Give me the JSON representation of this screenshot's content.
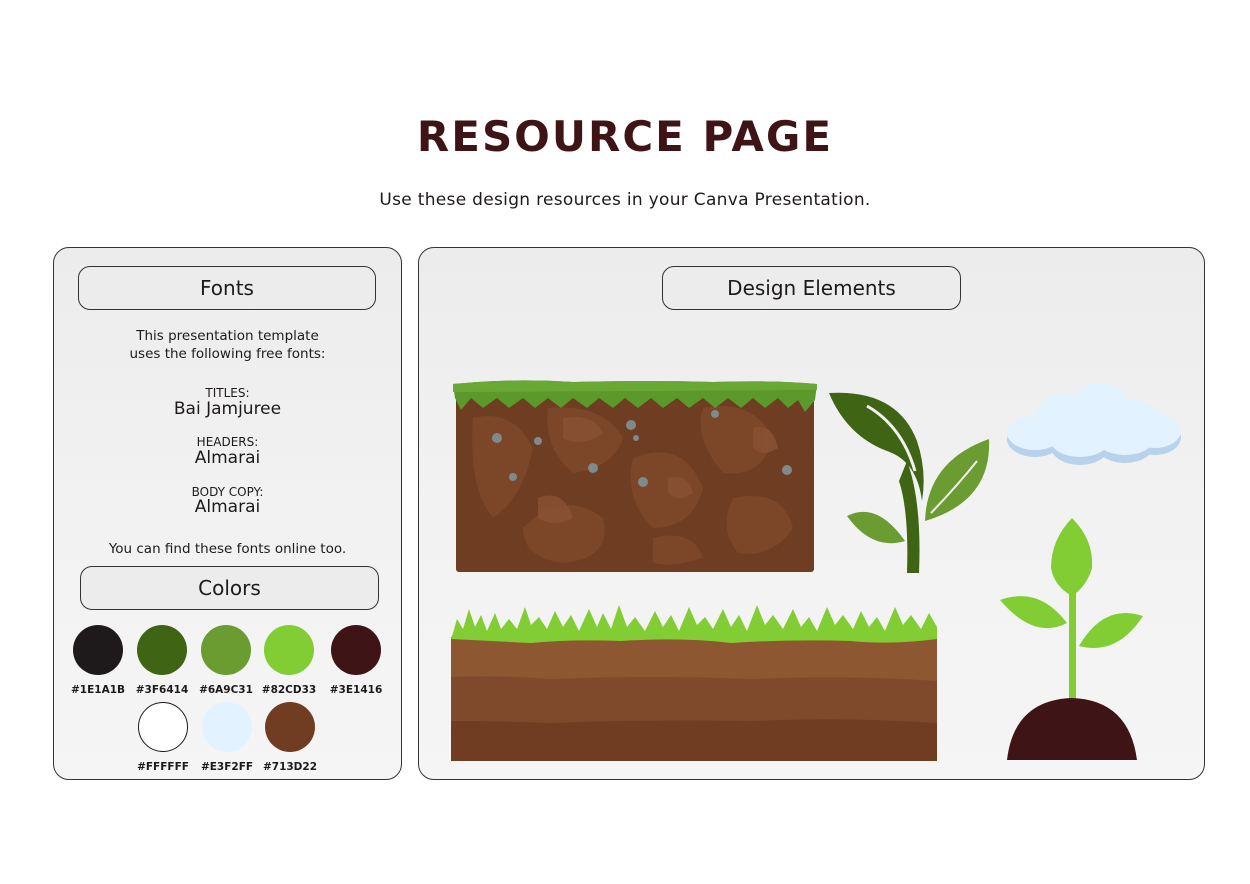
{
  "page": {
    "title": "RESOURCE PAGE",
    "subtitle": "Use these design resources in your Canva Presentation."
  },
  "fonts_panel": {
    "header": "Fonts",
    "intro_line1": "This presentation template",
    "intro_line2": "uses the following free fonts:",
    "entries": [
      {
        "label": "TITLES:",
        "font": "Bai Jamjuree"
      },
      {
        "label": "HEADERS:",
        "font": "Almarai"
      },
      {
        "label": "BODY COPY:",
        "font": "Almarai"
      }
    ],
    "footer": "You can find these fonts online too."
  },
  "colors_panel": {
    "header": "Colors",
    "swatches": [
      {
        "hex": "#1E1A1B",
        "color": "#1e1a1b"
      },
      {
        "hex": "#3F6414",
        "color": "#3f6414"
      },
      {
        "hex": "#6A9C31",
        "color": "#6a9c31"
      },
      {
        "hex": "#82CD33",
        "color": "#82cd33"
      },
      {
        "hex": "#3E1416",
        "color": "#3e1416"
      },
      {
        "hex": "#FFFFFF",
        "color": "#ffffff"
      },
      {
        "hex": "#E3F2FF",
        "color": "#e3f2ff"
      },
      {
        "hex": "#713D22",
        "color": "#713d22"
      }
    ]
  },
  "design_panel": {
    "header": "Design Elements",
    "elements": [
      "soil-block-with-grass",
      "dark-green-sprout",
      "cloud",
      "layered-soil-with-grass",
      "seedling-in-mound"
    ]
  }
}
